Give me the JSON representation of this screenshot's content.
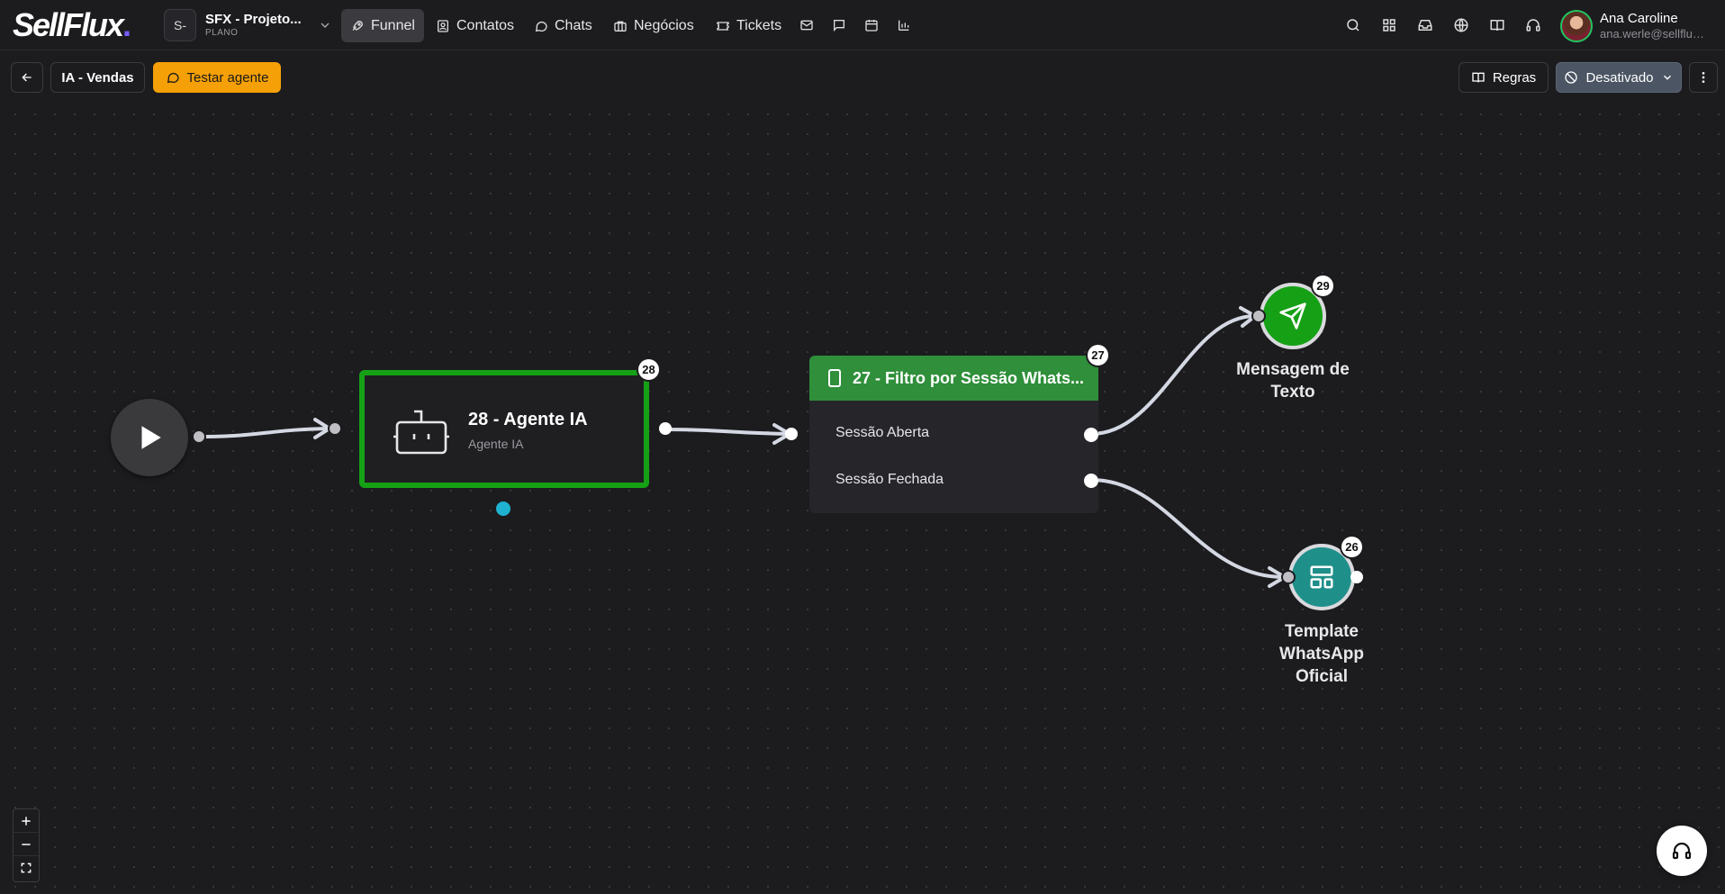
{
  "brand": {
    "logo_text": "SellFlux",
    "logo_dot": "."
  },
  "project": {
    "avatar_text": "S-",
    "name": "SFX - Projeto...",
    "plan": "PLANO"
  },
  "nav": {
    "funnel": "Funnel",
    "contatos": "Contatos",
    "chats": "Chats",
    "negocios": "Negócios",
    "tickets": "Tickets",
    "extra_icons": [
      "mail-icon",
      "message-square-icon",
      "calendar-icon",
      "bar-chart-icon"
    ]
  },
  "right_icons": [
    "search-icon",
    "grid-icon",
    "inbox-icon",
    "globe-icon",
    "book-icon",
    "headset-icon"
  ],
  "user": {
    "name": "Ana Caroline",
    "email": "ana.werle@sellflux..."
  },
  "toolbar": {
    "back_icon": "arrow-left-icon",
    "flow_name": "IA - Vendas",
    "test_agent": "Testar agente",
    "rules": "Regras",
    "status": "Desativado"
  },
  "flow": {
    "agent_node": {
      "badge": "28",
      "title": "28 - Agente IA",
      "subtitle": "Agente IA",
      "icon": "bot-icon"
    },
    "filter_node": {
      "badge": "27",
      "title": "27 - Filtro por Sessão Whats...",
      "outputs": [
        "Sessão Aberta",
        "Sessão Fechada"
      ],
      "icon": "smartphone-icon"
    },
    "message_node": {
      "badge": "29",
      "label": "Mensagem de Texto",
      "icon": "send-icon",
      "color": "#16a016"
    },
    "template_node": {
      "badge": "26",
      "label": "Template WhatsApp Oficial",
      "icon": "layout-template-icon",
      "color": "#1f8f8a"
    }
  },
  "zoom_controls": [
    "zoom-in-icon",
    "zoom-out-icon",
    "fit-view-icon"
  ],
  "colors": {
    "accent_orange": "#f5a007",
    "node_green": "#16a016",
    "header_green": "#2f8f3a",
    "teal": "#1f8f8a",
    "handle_cyan": "#1fb3d1"
  }
}
